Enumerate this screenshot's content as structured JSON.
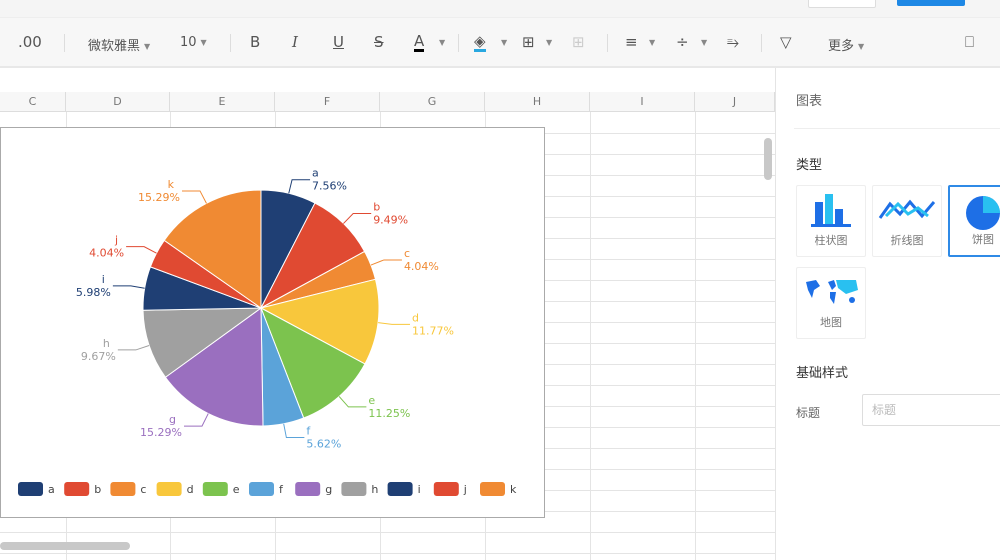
{
  "toolbar": {
    "decimal": ".00",
    "font": "微软雅黑",
    "size": "10",
    "bold": "B",
    "italic": "I",
    "underline": "U",
    "strike": "S",
    "fontcolor": "A",
    "more": "更多"
  },
  "columns": [
    "C",
    "D",
    "E",
    "F",
    "G",
    "H",
    "I",
    "J"
  ],
  "panel": {
    "title": "图表",
    "type_label": "类型",
    "types": [
      {
        "label": "柱状图",
        "icon": "bar-chart-icon"
      },
      {
        "label": "折线图",
        "icon": "line-chart-icon"
      },
      {
        "label": "饼图",
        "icon": "pie-chart-icon",
        "selected": true
      },
      {
        "label": "地图",
        "icon": "map-icon"
      }
    ],
    "basic_style": "基础样式",
    "title_label": "标题",
    "title_placeholder": "标题"
  },
  "chart_data": {
    "type": "pie",
    "categories": [
      "a",
      "b",
      "c",
      "d",
      "e",
      "f",
      "g",
      "h",
      "i",
      "j",
      "k"
    ],
    "values": [
      7.56,
      9.49,
      4.04,
      11.77,
      11.25,
      5.62,
      15.29,
      9.67,
      5.98,
      4.04,
      15.29
    ],
    "labels": [
      "7.56%",
      "9.49%",
      "4.04%",
      "11.77%",
      "11.25%",
      "5.62%",
      "15.29%",
      "9.67%",
      "5.98%",
      "4.04%",
      "15.29%"
    ],
    "colors": [
      "#1f3f74",
      "#e04a32",
      "#f08a33",
      "#f8c73c",
      "#7cc34e",
      "#5ba3d9",
      "#9a6fbf",
      "#a0a0a0",
      "#1f3f74",
      "#e04a32",
      "#f08a33"
    ],
    "legend": "bottom"
  }
}
